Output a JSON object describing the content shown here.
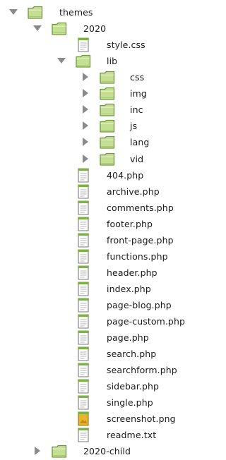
{
  "tree": [
    {
      "label": "themes",
      "type": "folder",
      "depth": 0,
      "state": "expanded"
    },
    {
      "label": "2020",
      "type": "folder",
      "depth": 1,
      "state": "expanded"
    },
    {
      "label": "style.css",
      "type": "file",
      "depth": 2
    },
    {
      "label": "lib",
      "type": "folder",
      "depth": 2,
      "state": "expanded"
    },
    {
      "label": "css",
      "type": "folder",
      "depth": 3,
      "state": "collapsed"
    },
    {
      "label": "img",
      "type": "folder",
      "depth": 3,
      "state": "collapsed"
    },
    {
      "label": "inc",
      "type": "folder",
      "depth": 3,
      "state": "collapsed"
    },
    {
      "label": "js",
      "type": "folder",
      "depth": 3,
      "state": "collapsed"
    },
    {
      "label": "lang",
      "type": "folder",
      "depth": 3,
      "state": "collapsed"
    },
    {
      "label": "vid",
      "type": "folder",
      "depth": 3,
      "state": "collapsed"
    },
    {
      "label": "404.php",
      "type": "file",
      "depth": 2
    },
    {
      "label": "archive.php",
      "type": "file",
      "depth": 2
    },
    {
      "label": "comments.php",
      "type": "file",
      "depth": 2
    },
    {
      "label": "footer.php",
      "type": "file",
      "depth": 2
    },
    {
      "label": "front-page.php",
      "type": "file",
      "depth": 2
    },
    {
      "label": "functions.php",
      "type": "file",
      "depth": 2
    },
    {
      "label": "header.php",
      "type": "file",
      "depth": 2
    },
    {
      "label": "index.php",
      "type": "file",
      "depth": 2
    },
    {
      "label": "page-blog.php",
      "type": "file",
      "depth": 2
    },
    {
      "label": "page-custom.php",
      "type": "file",
      "depth": 2
    },
    {
      "label": "page.php",
      "type": "file",
      "depth": 2
    },
    {
      "label": "search.php",
      "type": "file",
      "depth": 2
    },
    {
      "label": "searchform.php",
      "type": "file",
      "depth": 2
    },
    {
      "label": "sidebar.php",
      "type": "file",
      "depth": 2
    },
    {
      "label": "single.php",
      "type": "file",
      "depth": 2
    },
    {
      "label": "screenshot.png",
      "type": "image",
      "depth": 2
    },
    {
      "label": "readme.txt",
      "type": "file",
      "depth": 2
    },
    {
      "label": "2020-child",
      "type": "folder",
      "depth": 1,
      "state": "collapsed"
    }
  ],
  "icons": {
    "folder": "folder-icon",
    "file": "document-icon",
    "image": "image-file-icon",
    "expanded": "disclosure-triangle-down-icon",
    "collapsed": "disclosure-triangle-right-icon"
  },
  "colors": {
    "folder_fill": "#c4de92",
    "folder_stroke": "#6f9a3a",
    "file_tab": "#7cb342",
    "image_fill": "#e9b530",
    "triangle": "#8a8a8a",
    "text": "#1a1a1a"
  }
}
